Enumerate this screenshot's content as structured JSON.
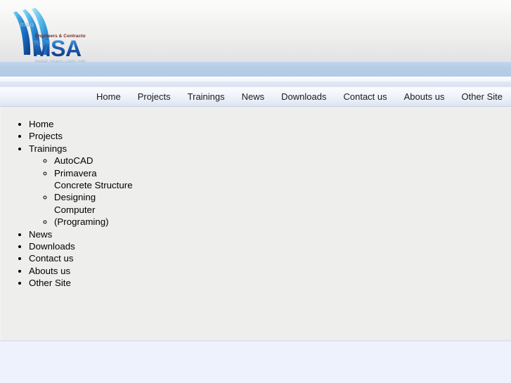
{
  "site": {
    "logo": {
      "brand": "MSA",
      "tagline": "Engineers & Contractors",
      "watermark": "msa",
      "subtext": "Mollah Shams Uddin Ahmed",
      "colors": {
        "swoosh_dark": "#0b3f8f",
        "swoosh_light": "#4fc3f7",
        "brand_blue": "#1f58b0",
        "tagline_red": "#8a2020"
      }
    }
  },
  "navbar": {
    "items": [
      {
        "label": "Home"
      },
      {
        "label": "Projects"
      },
      {
        "label": "Trainings"
      },
      {
        "label": "News"
      },
      {
        "label": "Downloads"
      },
      {
        "label": "Contact us"
      },
      {
        "label": "Abouts us"
      },
      {
        "label": "Other Site"
      }
    ]
  },
  "content": {
    "menu": [
      {
        "label": "Home",
        "children": []
      },
      {
        "label": "Projects",
        "children": []
      },
      {
        "label": "Trainings",
        "children": [
          {
            "label": "AutoCAD"
          },
          {
            "label": "Primavera"
          },
          {
            "label": "Concrete Structure Designing"
          },
          {
            "label": "Computer (Programing)"
          }
        ]
      },
      {
        "label": "News",
        "children": []
      },
      {
        "label": "Downloads",
        "children": []
      },
      {
        "label": "Contact us",
        "children": []
      },
      {
        "label": "Abouts us",
        "children": []
      },
      {
        "label": "Other Site",
        "children": []
      }
    ]
  },
  "colors": {
    "header_band_blue": "#b6cde7",
    "content_bg": "#eeeeec",
    "footer_bg": "#eef2fc",
    "nav_text": "#1b1b1b"
  }
}
